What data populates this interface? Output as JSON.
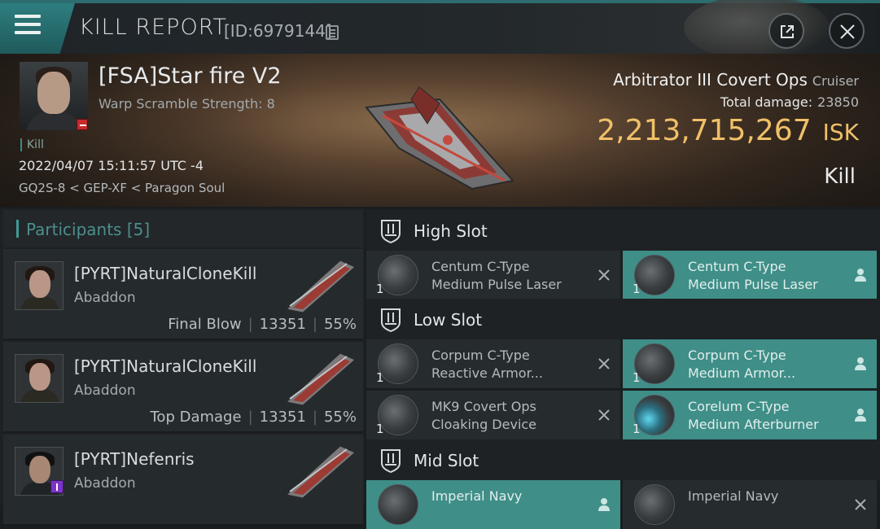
{
  "header": {
    "title": "KILL REPORT",
    "id_text": "[ID:6979144]"
  },
  "victim": {
    "name": "[FSA]Star fire V2",
    "subtitle": "Warp Scramble Strength: 8",
    "kill_tag": "Kill",
    "date": "2022/04/07 15:11:57 UTC -4",
    "location": "GQ2S-8 < GEP-XF < Paragon Soul",
    "ship_name": "Arbitrator III Covert Ops",
    "ship_class": "Cruiser",
    "total_damage_label": "Total damage:",
    "total_damage": "23850",
    "isk_value": "2,213,715,267",
    "isk_unit": "ISK",
    "result": "Kill"
  },
  "participants": {
    "label": "Participants",
    "count": "[5]",
    "rows": [
      {
        "name": "[PYRT]NaturalCloneKill",
        "ship": "Abaddon",
        "role": "Final Blow",
        "damage": "13351",
        "percent": "55%"
      },
      {
        "name": "[PYRT]NaturalCloneKill",
        "ship": "Abaddon",
        "role": "Top Damage",
        "damage": "13351",
        "percent": "55%"
      },
      {
        "name": "[PYRT]Nefenris",
        "ship": "Abaddon",
        "role": "",
        "damage": "",
        "percent": ""
      }
    ]
  },
  "fitting": {
    "high_slot": {
      "label": "High Slot",
      "destroyed": {
        "qty": "1",
        "name1": "Centum C-Type",
        "name2": "Medium Pulse Laser"
      },
      "dropped": {
        "qty": "1",
        "name1": "Centum C-Type",
        "name2": "Medium Pulse Laser"
      }
    },
    "low_slot": {
      "label": "Low Slot",
      "rows": [
        {
          "destroyed": {
            "qty": "1",
            "name1": "Corpum C-Type",
            "name2": "Reactive Armor..."
          },
          "dropped": {
            "qty": "1",
            "name1": "Corpum C-Type",
            "name2": "Medium Armor..."
          }
        },
        {
          "destroyed": {
            "qty": "1",
            "name1": "MK9 Covert Ops",
            "name2": "Cloaking Device"
          },
          "dropped": {
            "qty": "1",
            "name1": "Corelum C-Type",
            "name2": "Medium Afterburner"
          }
        }
      ]
    },
    "mid_slot": {
      "label": "Mid Slot",
      "dropped": {
        "name1": "Imperial Navy"
      },
      "destroyed": {
        "name1": "Imperial Navy"
      }
    }
  },
  "colors": {
    "accent_teal": "#3f8e88",
    "isk_gold": "#f0c068",
    "kill_badge_red": "#c62a2a"
  },
  "icons": [
    "menu-icon",
    "copy-icon",
    "share-icon",
    "close-icon",
    "shield-icon",
    "person-icon",
    "cross-icon"
  ]
}
